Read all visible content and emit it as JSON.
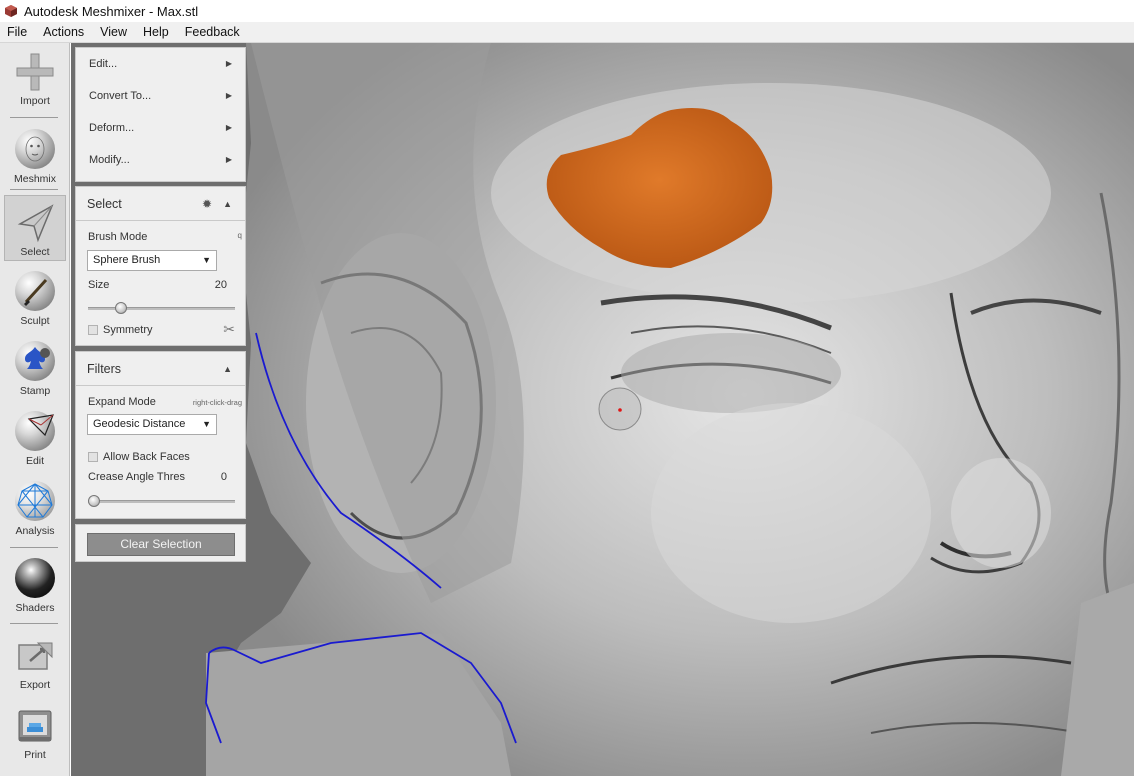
{
  "window": {
    "title": "Autodesk Meshmixer - Max.stl"
  },
  "menubar": {
    "items": [
      "File",
      "Actions",
      "View",
      "Help",
      "Feedback"
    ]
  },
  "toolbar": {
    "tools": [
      {
        "label": "Import",
        "icon": "plus-icon"
      },
      {
        "label": "Meshmix",
        "icon": "head-sphere-icon"
      },
      {
        "label": "Select",
        "icon": "select-arrow-icon",
        "active": true
      },
      {
        "label": "Sculpt",
        "icon": "brush-icon"
      },
      {
        "label": "Stamp",
        "icon": "stamp-icon"
      },
      {
        "label": "Edit",
        "icon": "edit-sphere-icon"
      },
      {
        "label": "Analysis",
        "icon": "analysis-mesh-icon"
      },
      {
        "label": "Shaders",
        "icon": "shader-sphere-icon"
      },
      {
        "label": "Export",
        "icon": "export-icon"
      },
      {
        "label": "Print",
        "icon": "printer-icon"
      }
    ]
  },
  "action_menu": {
    "items": [
      "Edit...",
      "Convert To...",
      "Deform...",
      "Modify..."
    ]
  },
  "select_panel": {
    "title": "Select",
    "brush_mode_label": "Brush Mode",
    "brush_mode_hint": "q",
    "brush_mode_value": "Sphere Brush",
    "size_label": "Size",
    "size_value": "20",
    "size_fraction": 0.2,
    "symmetry_label": "Symmetry"
  },
  "filters_panel": {
    "title": "Filters",
    "expand_mode_label": "Expand Mode",
    "expand_mode_hint": "right-click-drag",
    "expand_mode_value": "Geodesic Distance",
    "allow_back_faces_label": "Allow Back Faces",
    "crease_label": "Crease Angle Thres",
    "crease_value": "0",
    "crease_fraction": 0
  },
  "clear_selection_label": "Clear Selection",
  "colors": {
    "selection": "#d4671a",
    "boundary": "#1a1ad0",
    "viewport_bg": "#6e6e6e"
  }
}
